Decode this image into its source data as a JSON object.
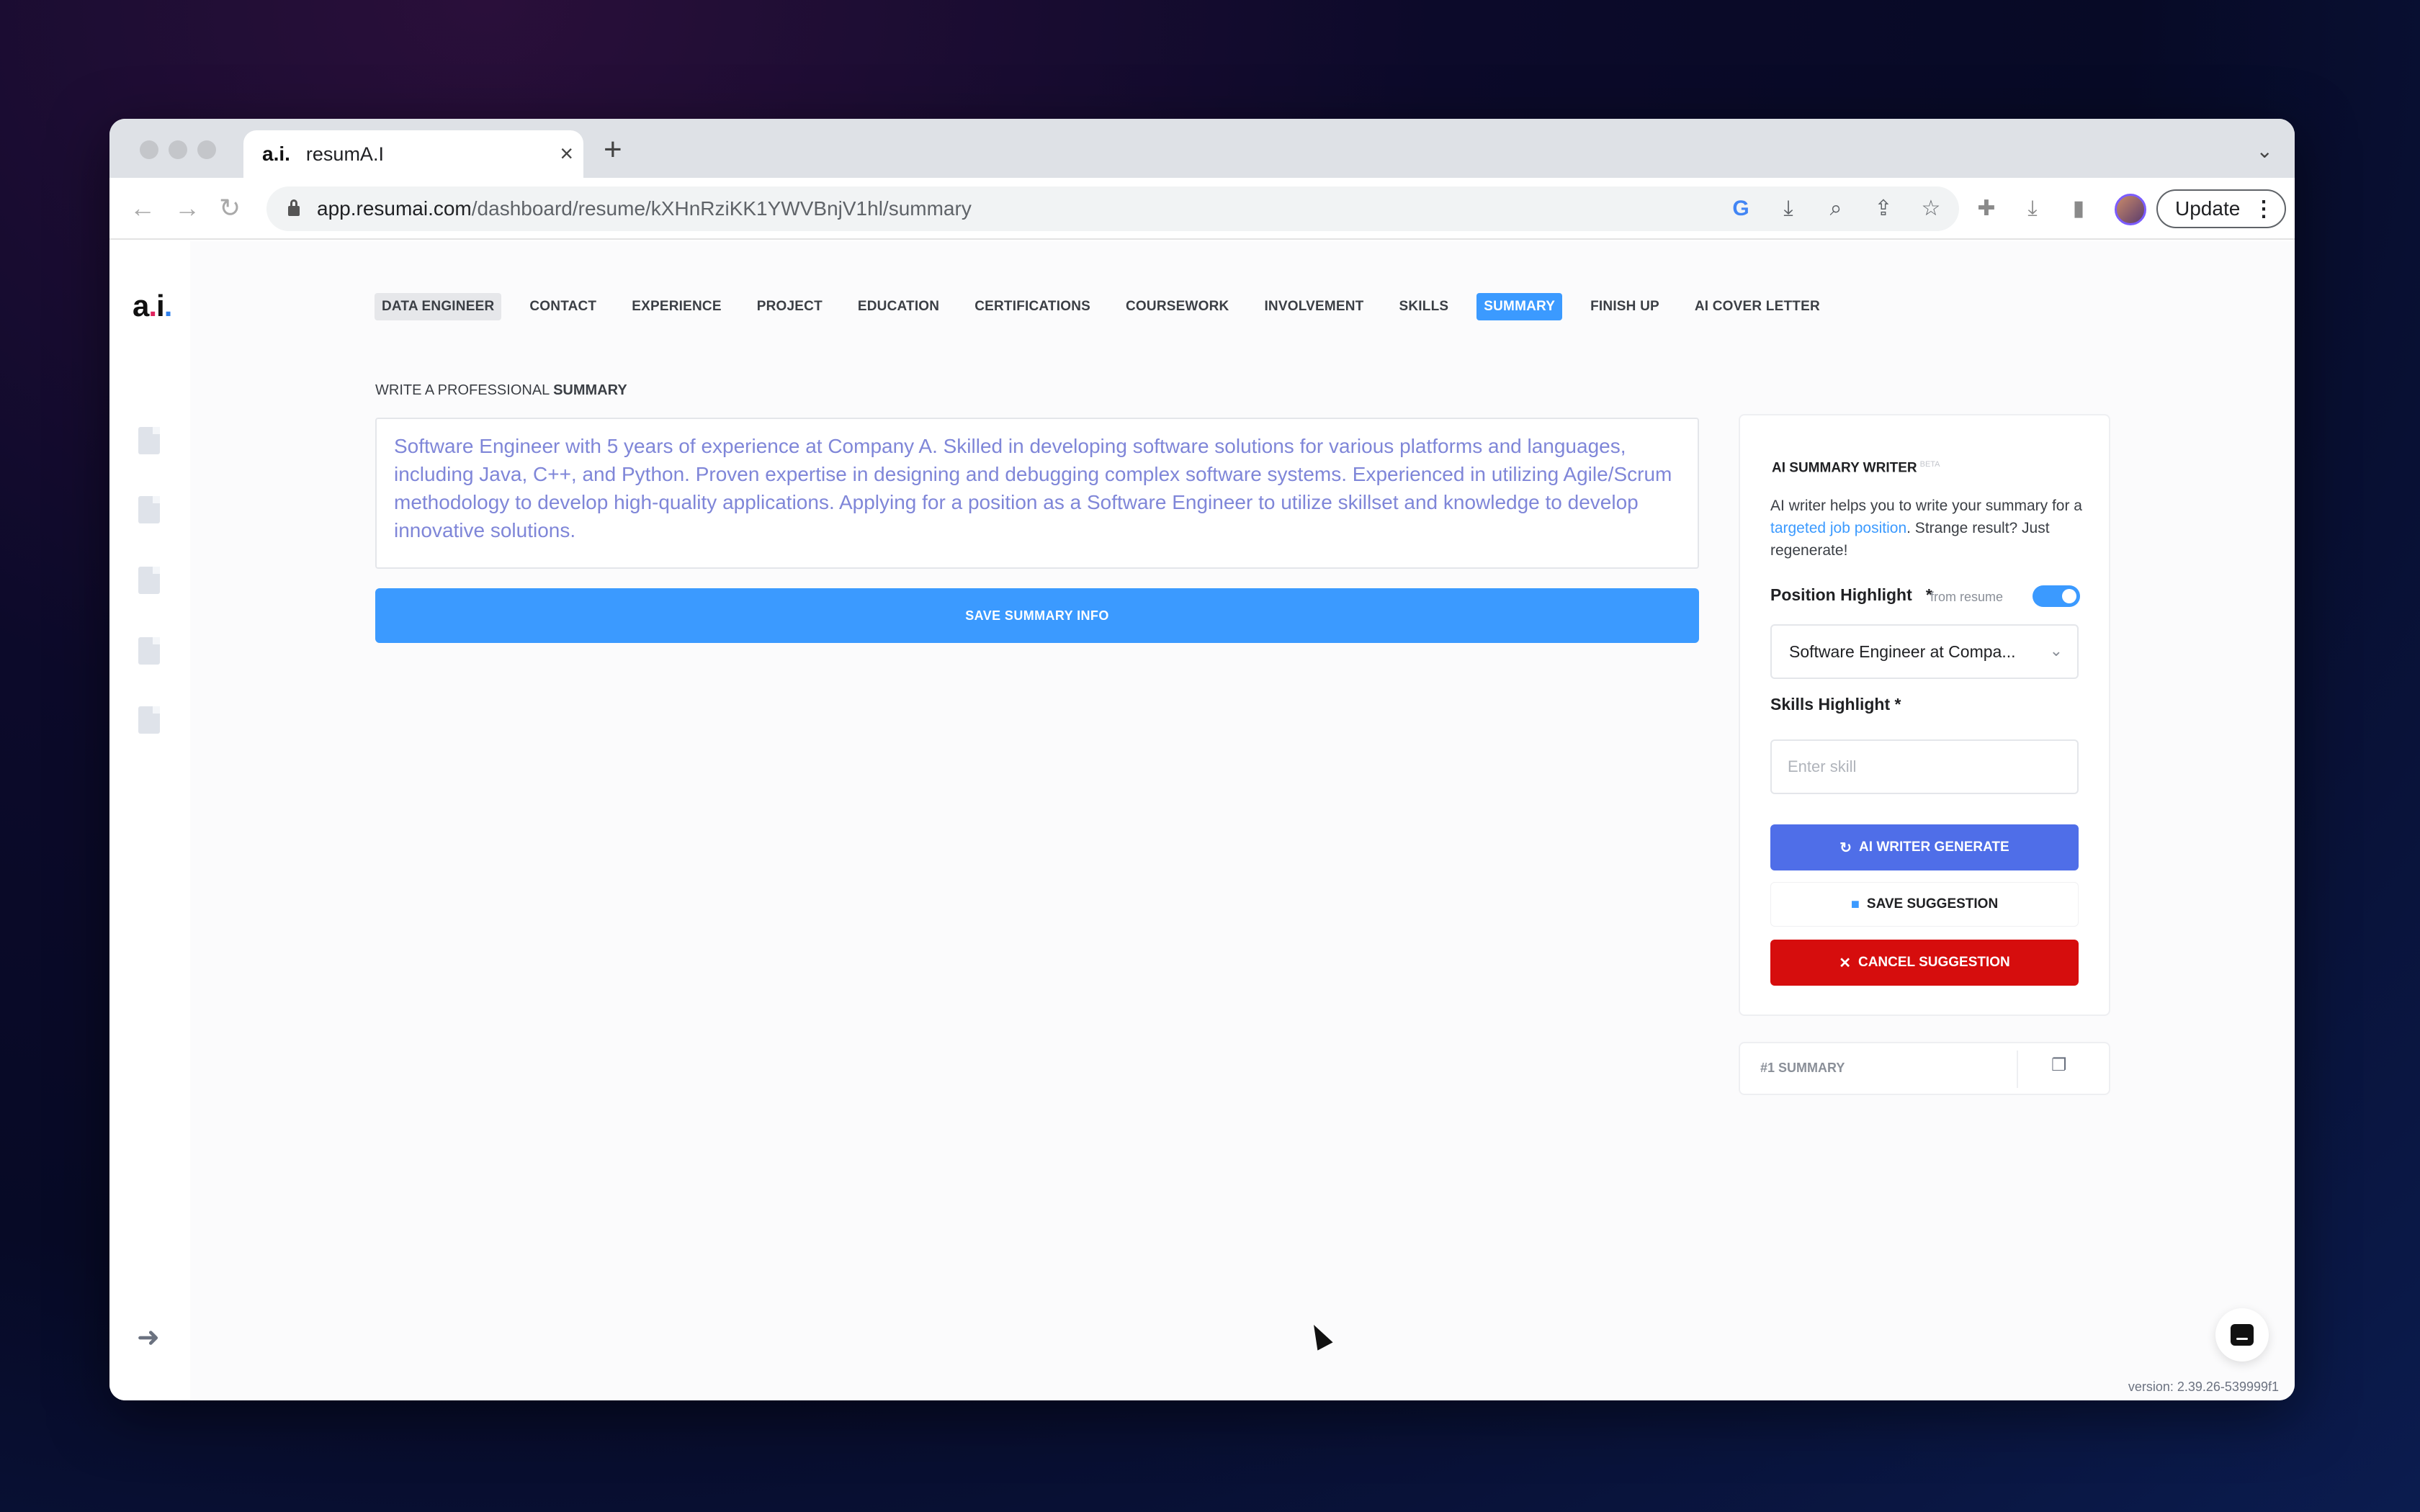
{
  "browser": {
    "tab_logo": "a.i.",
    "tab_title": "resumA.I",
    "url_host": "app.resumai.com",
    "url_path": "/dashboard/resume/kXHnRziKK1YWVBnjV1hl/summary",
    "update_label": "Update"
  },
  "app": {
    "logo": {
      "a": "a",
      "dot1": ".",
      "i": "i",
      "dot2": "."
    }
  },
  "nav": {
    "items": [
      "DATA ENGINEER",
      "CONTACT",
      "EXPERIENCE",
      "PROJECT",
      "EDUCATION",
      "CERTIFICATIONS",
      "COURSEWORK",
      "INVOLVEMENT",
      "SKILLS",
      "SUMMARY",
      "FINISH UP",
      "AI COVER LETTER"
    ],
    "active": "SUMMARY"
  },
  "main": {
    "section_prefix": "WRITE A PROFESSIONAL ",
    "section_bold": "SUMMARY",
    "summary_text": "Software Engineer with 5 years of experience at Company A. Skilled in developing software solutions for various platforms and languages, including Java, C++, and Python. Proven expertise in designing and debugging complex software systems. Experienced in utilizing Agile/Scrum methodology to develop high-quality applications. Applying for a position as a Software Engineer to utilize skillset and knowledge to develop innovative solutions.",
    "save_button": "SAVE SUMMARY INFO"
  },
  "ai_writer": {
    "title": "AI SUMMARY WRITER",
    "beta": "BETA",
    "desc_before": "AI writer helps you to write your summary for a ",
    "desc_link": "targeted job position",
    "desc_after": ". Strange result? Just regenerate!",
    "position_label": "Position Highlight",
    "required_mark": "*",
    "from_resume": "from resume",
    "position_value": "Software Engineer at Compa...",
    "skills_label": "Skills Highlight *",
    "skill_placeholder": "Enter skill",
    "generate_button": "AI WRITER GENERATE",
    "save_button": "SAVE SUGGESTION",
    "cancel_button": "CANCEL SUGGESTION"
  },
  "summary_card": {
    "label": "#1 SUMMARY"
  },
  "version": "version: 2.39.26-539999f1",
  "colors": {
    "accent": "#3b9aff",
    "generate": "#4f6ee8",
    "cancel": "#d60d0d",
    "summary_text": "#7f86d8"
  },
  "icons": [
    "back-arrow-icon",
    "forward-arrow-icon",
    "reload-icon",
    "lock-icon",
    "google-icon",
    "install-icon",
    "zoom-icon",
    "share-icon",
    "star-icon",
    "extensions-icon",
    "download-icon",
    "sidepanel-icon",
    "refresh-icon",
    "save-icon",
    "close-x-icon",
    "copy-icon",
    "logout-icon",
    "chat-icon"
  ]
}
